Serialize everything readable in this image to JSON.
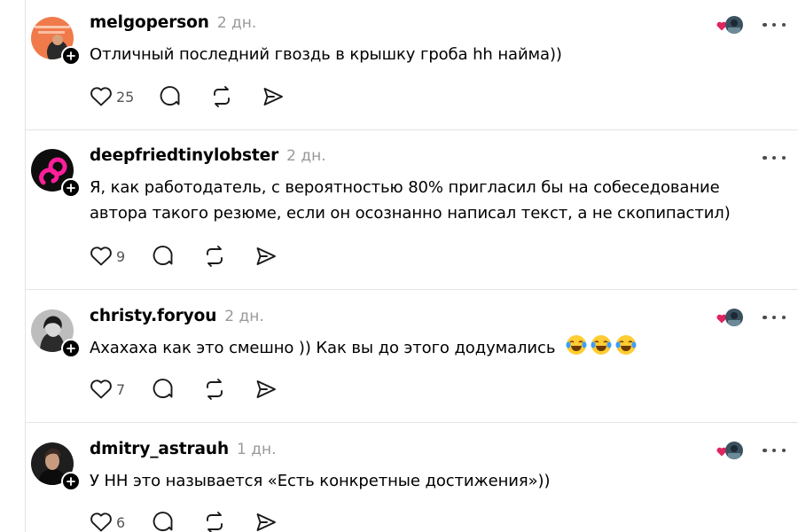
{
  "posts": [
    {
      "username": "melgoperson",
      "time": "2 дн.",
      "text": "Отличный последний гвоздь в крышку гроба hh найма))",
      "likes": "25",
      "liked_by_follower": true
    },
    {
      "username": "deepfriedtinylobster",
      "time": "2 дн.",
      "text": "Я, как работодатель, с вероятностью 80% пригласил бы на собеседование автора такого резюме, если он осознанно написал текст, а не скопипастил)",
      "likes": "9",
      "liked_by_follower": false
    },
    {
      "username": "christy.foryou",
      "time": "2 дн.",
      "text": "Ахахаха как это смешно )) Как вы до этого додумались",
      "emojis": [
        "😂",
        "😂",
        "😂"
      ],
      "likes": "7",
      "liked_by_follower": true
    },
    {
      "username": "dmitry_astrauh",
      "time": "1 дн.",
      "text": "У НН это называется «Есть конкретные достижения»))",
      "likes": "6",
      "liked_by_follower": true
    }
  ],
  "icons": {
    "like": "heart-outline-icon",
    "reply": "speech-bubble-icon",
    "repost": "repost-arrows-icon",
    "share": "send-arrow-icon",
    "more": "more-horizontal-icon",
    "follow": "plus-icon"
  },
  "colors": {
    "text": "#000000",
    "muted": "#999999",
    "divider": "#e3e3e3",
    "liked_heart": "#e0245e"
  }
}
